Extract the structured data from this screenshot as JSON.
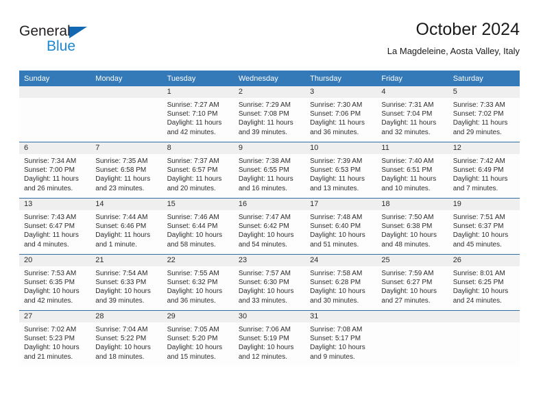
{
  "brand": {
    "name_part1": "General",
    "name_part2": "Blue",
    "logo_icon": "triangle-flag-icon",
    "color_blue": "#1b87d2",
    "color_dark": "#231f20"
  },
  "header": {
    "title": "October 2024",
    "subtitle": "La Magdeleine, Aosta Valley, Italy"
  },
  "theme": {
    "header_row_bg": "#3479b8",
    "header_row_text": "#ffffff",
    "row_divider": "#2e6da4",
    "daynum_band_bg": "#efefef",
    "cell_bg": "#fdfdfd",
    "text": "#2b2b2b"
  },
  "calendar": {
    "weekday_headers": [
      "Sunday",
      "Monday",
      "Tuesday",
      "Wednesday",
      "Thursday",
      "Friday",
      "Saturday"
    ],
    "labels": {
      "sunrise": "Sunrise:",
      "sunset": "Sunset:",
      "daylight": "Daylight:"
    },
    "weeks": [
      [
        {
          "day": "",
          "sunrise": "",
          "sunset": "",
          "daylight_line1": "",
          "daylight_line2": ""
        },
        {
          "day": "",
          "sunrise": "",
          "sunset": "",
          "daylight_line1": "",
          "daylight_line2": ""
        },
        {
          "day": "1",
          "sunrise": "Sunrise: 7:27 AM",
          "sunset": "Sunset: 7:10 PM",
          "daylight_line1": "Daylight: 11 hours",
          "daylight_line2": "and 42 minutes."
        },
        {
          "day": "2",
          "sunrise": "Sunrise: 7:29 AM",
          "sunset": "Sunset: 7:08 PM",
          "daylight_line1": "Daylight: 11 hours",
          "daylight_line2": "and 39 minutes."
        },
        {
          "day": "3",
          "sunrise": "Sunrise: 7:30 AM",
          "sunset": "Sunset: 7:06 PM",
          "daylight_line1": "Daylight: 11 hours",
          "daylight_line2": "and 36 minutes."
        },
        {
          "day": "4",
          "sunrise": "Sunrise: 7:31 AM",
          "sunset": "Sunset: 7:04 PM",
          "daylight_line1": "Daylight: 11 hours",
          "daylight_line2": "and 32 minutes."
        },
        {
          "day": "5",
          "sunrise": "Sunrise: 7:33 AM",
          "sunset": "Sunset: 7:02 PM",
          "daylight_line1": "Daylight: 11 hours",
          "daylight_line2": "and 29 minutes."
        }
      ],
      [
        {
          "day": "6",
          "sunrise": "Sunrise: 7:34 AM",
          "sunset": "Sunset: 7:00 PM",
          "daylight_line1": "Daylight: 11 hours",
          "daylight_line2": "and 26 minutes."
        },
        {
          "day": "7",
          "sunrise": "Sunrise: 7:35 AM",
          "sunset": "Sunset: 6:58 PM",
          "daylight_line1": "Daylight: 11 hours",
          "daylight_line2": "and 23 minutes."
        },
        {
          "day": "8",
          "sunrise": "Sunrise: 7:37 AM",
          "sunset": "Sunset: 6:57 PM",
          "daylight_line1": "Daylight: 11 hours",
          "daylight_line2": "and 20 minutes."
        },
        {
          "day": "9",
          "sunrise": "Sunrise: 7:38 AM",
          "sunset": "Sunset: 6:55 PM",
          "daylight_line1": "Daylight: 11 hours",
          "daylight_line2": "and 16 minutes."
        },
        {
          "day": "10",
          "sunrise": "Sunrise: 7:39 AM",
          "sunset": "Sunset: 6:53 PM",
          "daylight_line1": "Daylight: 11 hours",
          "daylight_line2": "and 13 minutes."
        },
        {
          "day": "11",
          "sunrise": "Sunrise: 7:40 AM",
          "sunset": "Sunset: 6:51 PM",
          "daylight_line1": "Daylight: 11 hours",
          "daylight_line2": "and 10 minutes."
        },
        {
          "day": "12",
          "sunrise": "Sunrise: 7:42 AM",
          "sunset": "Sunset: 6:49 PM",
          "daylight_line1": "Daylight: 11 hours",
          "daylight_line2": "and 7 minutes."
        }
      ],
      [
        {
          "day": "13",
          "sunrise": "Sunrise: 7:43 AM",
          "sunset": "Sunset: 6:47 PM",
          "daylight_line1": "Daylight: 11 hours",
          "daylight_line2": "and 4 minutes."
        },
        {
          "day": "14",
          "sunrise": "Sunrise: 7:44 AM",
          "sunset": "Sunset: 6:46 PM",
          "daylight_line1": "Daylight: 11 hours",
          "daylight_line2": "and 1 minute."
        },
        {
          "day": "15",
          "sunrise": "Sunrise: 7:46 AM",
          "sunset": "Sunset: 6:44 PM",
          "daylight_line1": "Daylight: 10 hours",
          "daylight_line2": "and 58 minutes."
        },
        {
          "day": "16",
          "sunrise": "Sunrise: 7:47 AM",
          "sunset": "Sunset: 6:42 PM",
          "daylight_line1": "Daylight: 10 hours",
          "daylight_line2": "and 54 minutes."
        },
        {
          "day": "17",
          "sunrise": "Sunrise: 7:48 AM",
          "sunset": "Sunset: 6:40 PM",
          "daylight_line1": "Daylight: 10 hours",
          "daylight_line2": "and 51 minutes."
        },
        {
          "day": "18",
          "sunrise": "Sunrise: 7:50 AM",
          "sunset": "Sunset: 6:38 PM",
          "daylight_line1": "Daylight: 10 hours",
          "daylight_line2": "and 48 minutes."
        },
        {
          "day": "19",
          "sunrise": "Sunrise: 7:51 AM",
          "sunset": "Sunset: 6:37 PM",
          "daylight_line1": "Daylight: 10 hours",
          "daylight_line2": "and 45 minutes."
        }
      ],
      [
        {
          "day": "20",
          "sunrise": "Sunrise: 7:53 AM",
          "sunset": "Sunset: 6:35 PM",
          "daylight_line1": "Daylight: 10 hours",
          "daylight_line2": "and 42 minutes."
        },
        {
          "day": "21",
          "sunrise": "Sunrise: 7:54 AM",
          "sunset": "Sunset: 6:33 PM",
          "daylight_line1": "Daylight: 10 hours",
          "daylight_line2": "and 39 minutes."
        },
        {
          "day": "22",
          "sunrise": "Sunrise: 7:55 AM",
          "sunset": "Sunset: 6:32 PM",
          "daylight_line1": "Daylight: 10 hours",
          "daylight_line2": "and 36 minutes."
        },
        {
          "day": "23",
          "sunrise": "Sunrise: 7:57 AM",
          "sunset": "Sunset: 6:30 PM",
          "daylight_line1": "Daylight: 10 hours",
          "daylight_line2": "and 33 minutes."
        },
        {
          "day": "24",
          "sunrise": "Sunrise: 7:58 AM",
          "sunset": "Sunset: 6:28 PM",
          "daylight_line1": "Daylight: 10 hours",
          "daylight_line2": "and 30 minutes."
        },
        {
          "day": "25",
          "sunrise": "Sunrise: 7:59 AM",
          "sunset": "Sunset: 6:27 PM",
          "daylight_line1": "Daylight: 10 hours",
          "daylight_line2": "and 27 minutes."
        },
        {
          "day": "26",
          "sunrise": "Sunrise: 8:01 AM",
          "sunset": "Sunset: 6:25 PM",
          "daylight_line1": "Daylight: 10 hours",
          "daylight_line2": "and 24 minutes."
        }
      ],
      [
        {
          "day": "27",
          "sunrise": "Sunrise: 7:02 AM",
          "sunset": "Sunset: 5:23 PM",
          "daylight_line1": "Daylight: 10 hours",
          "daylight_line2": "and 21 minutes."
        },
        {
          "day": "28",
          "sunrise": "Sunrise: 7:04 AM",
          "sunset": "Sunset: 5:22 PM",
          "daylight_line1": "Daylight: 10 hours",
          "daylight_line2": "and 18 minutes."
        },
        {
          "day": "29",
          "sunrise": "Sunrise: 7:05 AM",
          "sunset": "Sunset: 5:20 PM",
          "daylight_line1": "Daylight: 10 hours",
          "daylight_line2": "and 15 minutes."
        },
        {
          "day": "30",
          "sunrise": "Sunrise: 7:06 AM",
          "sunset": "Sunset: 5:19 PM",
          "daylight_line1": "Daylight: 10 hours",
          "daylight_line2": "and 12 minutes."
        },
        {
          "day": "31",
          "sunrise": "Sunrise: 7:08 AM",
          "sunset": "Sunset: 5:17 PM",
          "daylight_line1": "Daylight: 10 hours",
          "daylight_line2": "and 9 minutes."
        },
        {
          "day": "",
          "sunrise": "",
          "sunset": "",
          "daylight_line1": "",
          "daylight_line2": ""
        },
        {
          "day": "",
          "sunrise": "",
          "sunset": "",
          "daylight_line1": "",
          "daylight_line2": ""
        }
      ]
    ]
  }
}
